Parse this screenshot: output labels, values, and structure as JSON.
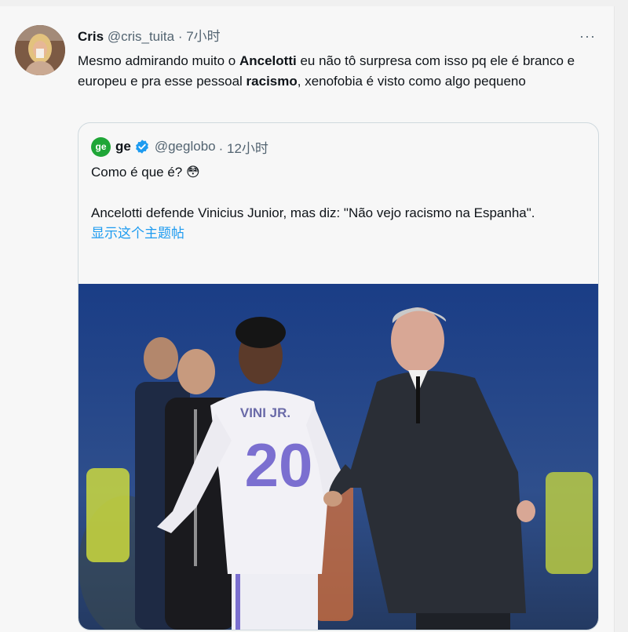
{
  "tweet": {
    "author_name": "Cris",
    "author_handle": "@cris_tuita",
    "time": "· 7小时",
    "more": "···",
    "text_parts": [
      "Mesmo admirando muito o ",
      "Ancelotti",
      " eu não tô surpresa com isso pq ele é branco e europeu e pra esse pessoal ",
      "racismo",
      ", xenofobia é visto como algo pequeno"
    ]
  },
  "quote": {
    "logo_text": "ge",
    "name": "ge",
    "handle": "@geglobo",
    "time": "· 12小时",
    "line1": "Como é que é? 😳",
    "line2": "Ancelotti defende Vinicius Junior, mas diz: \"Não vejo racismo na Espanha\".",
    "show_thread": "显示这个主题帖",
    "photo": {
      "jersey_name": "VINI JR.",
      "jersey_number": "20"
    }
  },
  "colors": {
    "link": "#1d9bf0",
    "verified": "#1d9bf0",
    "ge_green": "#1fa637",
    "jersey_number": "#7b6fd0"
  }
}
